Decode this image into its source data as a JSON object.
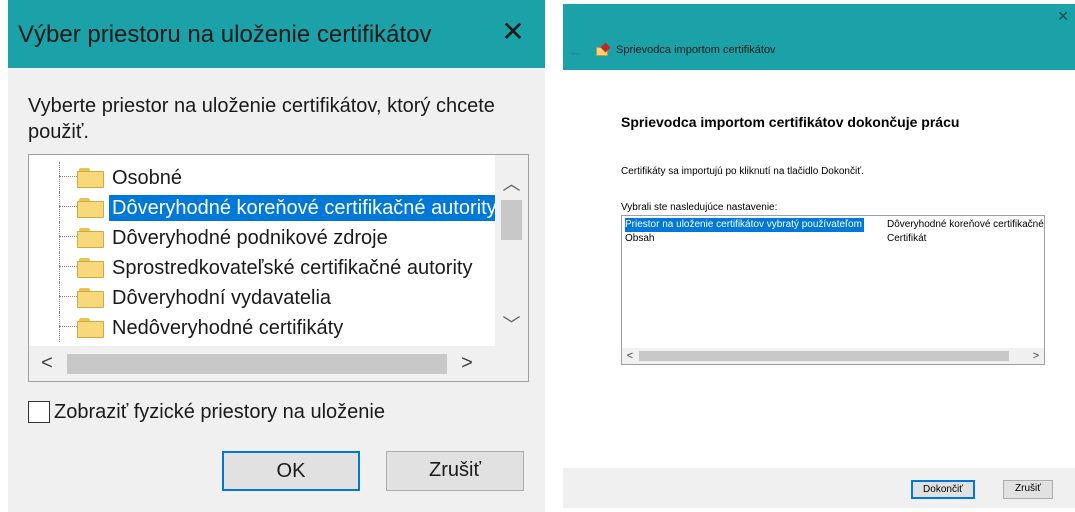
{
  "store_dialog": {
    "title": "Výber priestoru na uloženie certifikátov",
    "close_glyph": "✕",
    "prompt": "Vyberte priestor na uloženie certifikátov, ktorý chcete použiť.",
    "stores": [
      {
        "label": "Osobné",
        "selected": false
      },
      {
        "label": "Dôveryhodné koreňové certifikačné autority",
        "selected": true
      },
      {
        "label": "Dôveryhodné podnikové zdroje",
        "selected": false
      },
      {
        "label": "Sprostredkovateľské certifikačné autority",
        "selected": false
      },
      {
        "label": "Dôveryhodní vydavatelia",
        "selected": false
      },
      {
        "label": "Nedôveryhodné certifikáty",
        "selected": false
      }
    ],
    "scroll_up_glyph": "︿",
    "scroll_down_glyph": "﹀",
    "scroll_left_glyph": "<",
    "scroll_right_glyph": ">",
    "show_physical_label": "Zobraziť fyzické priestory na uloženie",
    "show_physical_checked": false,
    "ok_label": "OK",
    "cancel_label": "Zrušiť"
  },
  "wizard": {
    "close_glyph": "✕",
    "back_glyph": "←",
    "title": "Sprievodca importom certifikátov",
    "heading": "Sprievodca importom certifikátov dokončuje prácu",
    "info": "Certifikáty sa importujú po kliknutí na tlačidlo Dokončiť.",
    "settings_label": "Vybrali ste nasledujúce nastavenie:",
    "settings": [
      {
        "name": "Priestor na uloženie certifikátov vybratý používateľom",
        "value": "Dôveryhodné koreňové certifikačné autority",
        "selected": true
      },
      {
        "name": "Obsah",
        "value": "Certifikát",
        "selected": false
      }
    ],
    "scroll_left_glyph": "<",
    "scroll_right_glyph": ">",
    "finish_label": "Dokončiť",
    "cancel_label": "Zrušiť"
  },
  "colors": {
    "titlebar": "#1ba1a8",
    "selection": "#0078d7",
    "dialog_bg": "#f0f0f0"
  }
}
